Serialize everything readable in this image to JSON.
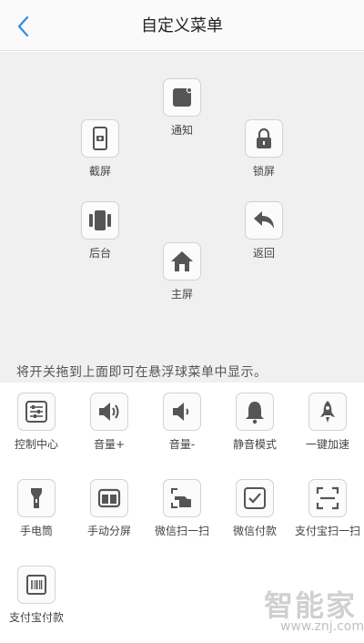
{
  "header": {
    "title": "自定义菜单",
    "back_icon": "chevron-left-icon",
    "back_color": "#2f8fe0"
  },
  "float_menu": {
    "items": [
      {
        "label": "通知",
        "icon": "notification-icon"
      },
      {
        "label": "截屏",
        "icon": "screenshot-icon"
      },
      {
        "label": "锁屏",
        "icon": "lock-icon"
      },
      {
        "label": "后台",
        "icon": "recents-icon"
      },
      {
        "label": "返回",
        "icon": "back-arrow-icon"
      },
      {
        "label": "主屏",
        "icon": "home-icon"
      }
    ]
  },
  "hint": "将开关拖到上面即可在悬浮球菜单中显示。",
  "toggles": [
    {
      "label": "控制中心",
      "icon": "sliders-icon"
    },
    {
      "label": "音量+",
      "icon": "volume-up-icon"
    },
    {
      "label": "音量-",
      "icon": "volume-down-icon"
    },
    {
      "label": "静音模式",
      "icon": "bell-icon"
    },
    {
      "label": "一键加速",
      "icon": "rocket-icon"
    },
    {
      "label": "手电筒",
      "icon": "flashlight-icon"
    },
    {
      "label": "手动分屏",
      "icon": "split-screen-icon"
    },
    {
      "label": "微信扫一扫",
      "icon": "wechat-scan-icon"
    },
    {
      "label": "微信付款",
      "icon": "wechat-pay-icon"
    },
    {
      "label": "支付宝扫一扫",
      "icon": "alipay-scan-icon"
    },
    {
      "label": "支付宝付款",
      "icon": "alipay-pay-icon"
    }
  ],
  "watermark": {
    "text": "智能家",
    "url": "www.znj.com"
  }
}
